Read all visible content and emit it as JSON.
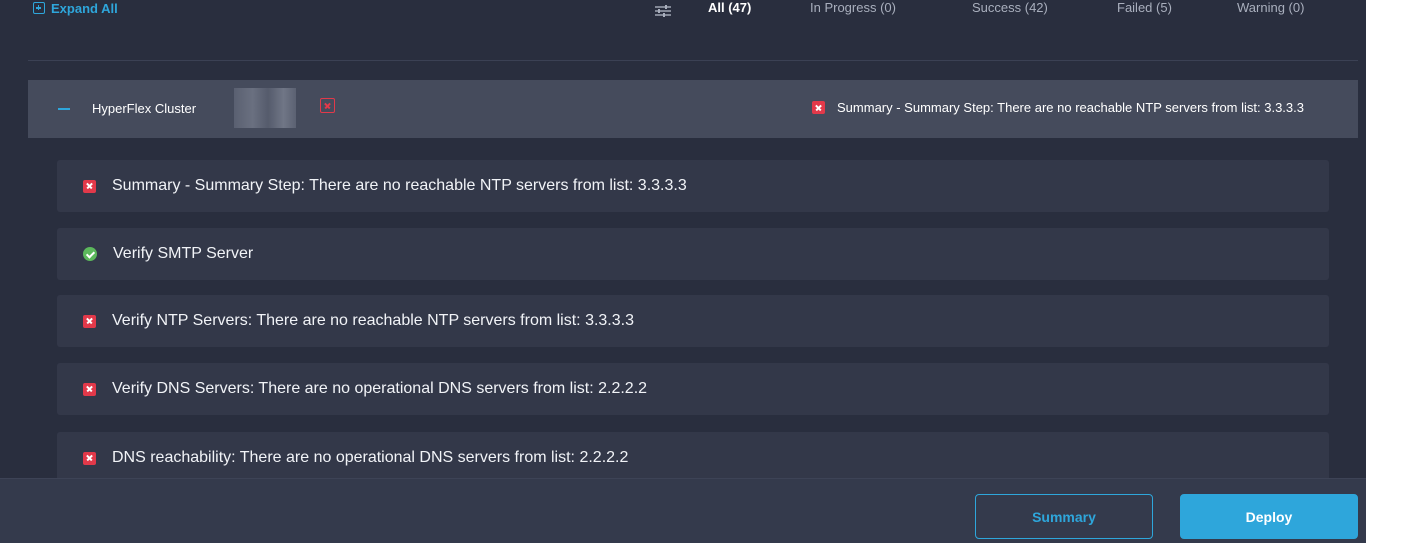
{
  "toolbar": {
    "expand_all_label": "Expand All",
    "filters": [
      {
        "label": "All (47)",
        "active": true
      },
      {
        "label": "In Progress (0)",
        "active": false
      },
      {
        "label": "Success (42)",
        "active": false
      },
      {
        "label": "Failed (5)",
        "active": false
      },
      {
        "label": "Warning (0)",
        "active": false
      }
    ]
  },
  "cluster": {
    "title": "HyperFlex Cluster",
    "status_icon": "error-icon",
    "status_text": "Summary - Summary Step: There are no reachable NTP servers from list: 3.3.3.3"
  },
  "steps": [
    {
      "status": "error",
      "text": "Summary - Summary Step: There are no reachable NTP servers from list: 3.3.3.3"
    },
    {
      "status": "success",
      "text": "Verify SMTP Server"
    },
    {
      "status": "error",
      "text": "Verify NTP Servers: There are no reachable NTP servers from list: 3.3.3.3"
    },
    {
      "status": "error",
      "text": "Verify DNS Servers: There are no operational DNS servers from list: 2.2.2.2"
    },
    {
      "status": "error",
      "text": "DNS reachability: There are no operational DNS servers from list: 2.2.2.2"
    }
  ],
  "footer": {
    "summary_label": "Summary",
    "deploy_label": "Deploy"
  },
  "colors": {
    "background": "#292e3e",
    "accent": "#2ea6db",
    "error": "#e2394a",
    "success": "#5cb85c"
  }
}
